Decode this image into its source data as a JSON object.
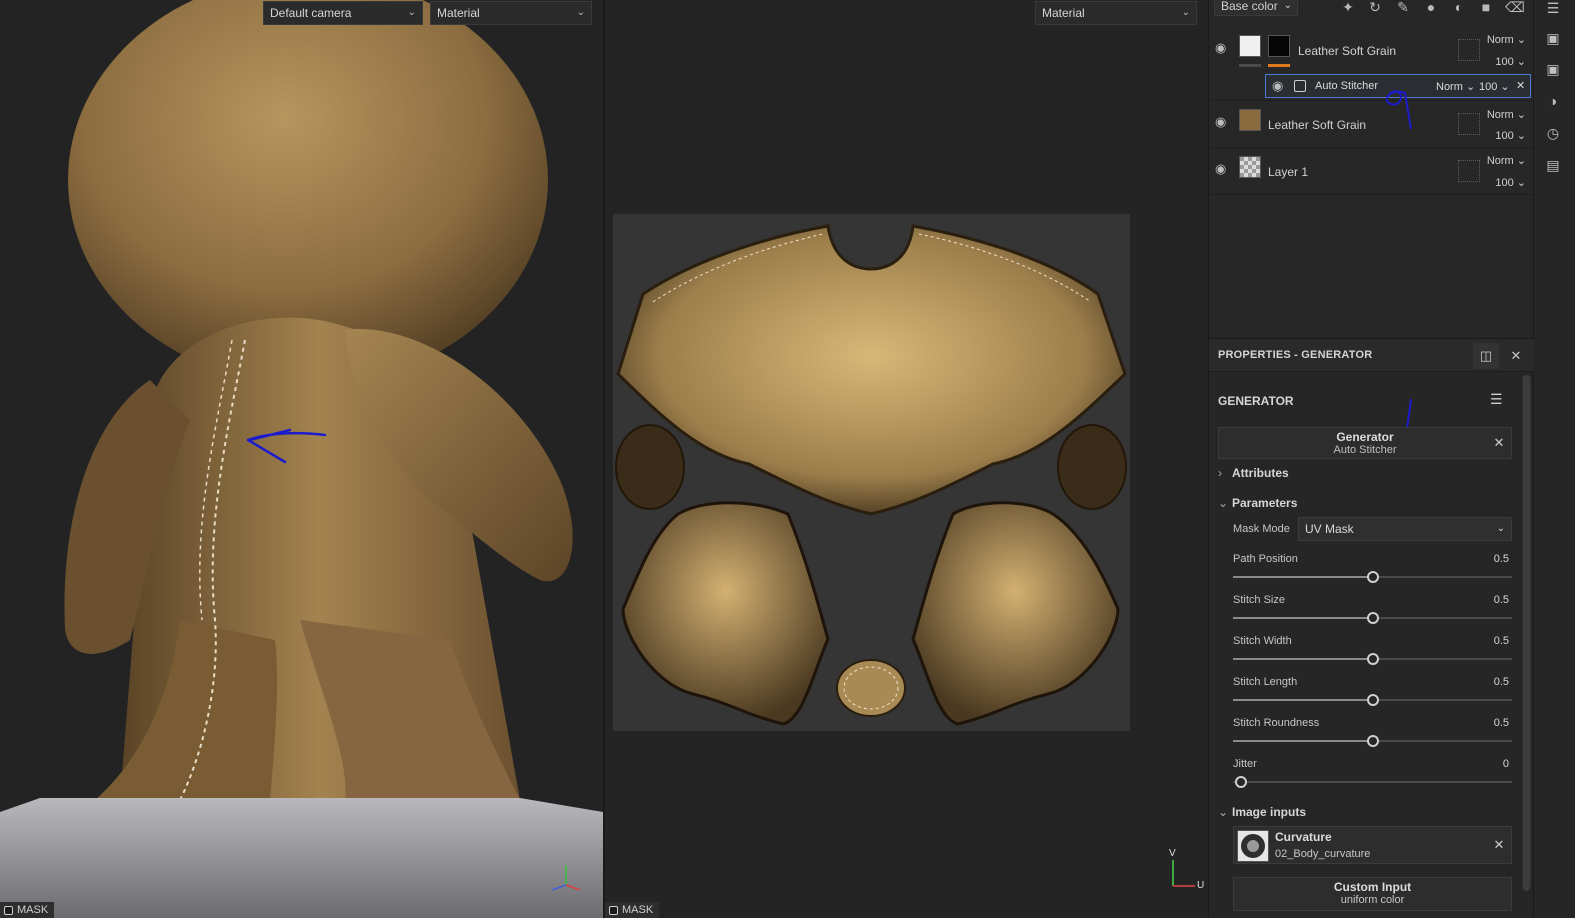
{
  "viewport3d": {
    "camera_select": "Default camera",
    "material_select": "Material",
    "mask_label": "MASK"
  },
  "viewportUV": {
    "material_select": "Material",
    "mask_label": "MASK",
    "axis_v": "V",
    "axis_u": "U"
  },
  "layers": {
    "channel_select": "Base color",
    "toolbar_icons": [
      "magic-wand-icon",
      "rotate-icon",
      "brush-icon",
      "fill-bucket-icon",
      "smart-material-icon",
      "folder-icon",
      "trash-icon"
    ],
    "rows": [
      {
        "name": "Leather Soft Grain",
        "blend": "Norm",
        "opacity": "100"
      },
      {
        "name": "Auto Stitcher",
        "blend": "Norm",
        "opacity": "100"
      },
      {
        "name": "Leather Soft Grain",
        "blend": "Norm",
        "opacity": "100"
      },
      {
        "name": "Layer 1",
        "blend": "Norm",
        "opacity": "100"
      }
    ]
  },
  "properties": {
    "header": "PROPERTIES - GENERATOR",
    "section": "GENERATOR",
    "generator_title": "Generator",
    "generator_name": "Auto Stitcher",
    "attributes": "Attributes",
    "parameters": "Parameters",
    "mask_mode_label": "Mask Mode",
    "mask_mode_value": "UV Mask",
    "sliders": [
      {
        "label": "Path Position",
        "value": "0.5",
        "fraction": 0.5
      },
      {
        "label": "Stitch Size",
        "value": "0.5",
        "fraction": 0.5
      },
      {
        "label": "Stitch Width",
        "value": "0.5",
        "fraction": 0.5
      },
      {
        "label": "Stitch Length",
        "value": "0.5",
        "fraction": 0.5
      },
      {
        "label": "Stitch Roundness",
        "value": "0.5",
        "fraction": 0.5
      },
      {
        "label": "Jitter",
        "value": "0",
        "fraction": 0.0
      }
    ],
    "image_inputs": "Image inputs",
    "curvature_title": "Curvature",
    "curvature_file": "02_Body_curvature",
    "custom_input_title": "Custom Input",
    "custom_input_value": "uniform color"
  },
  "colors": {
    "leather": "#8a6b3d",
    "accent_blue": "#4a7bd0",
    "annotation_ink": "#1c1ccc",
    "orange_bar": "#e07a1f"
  }
}
